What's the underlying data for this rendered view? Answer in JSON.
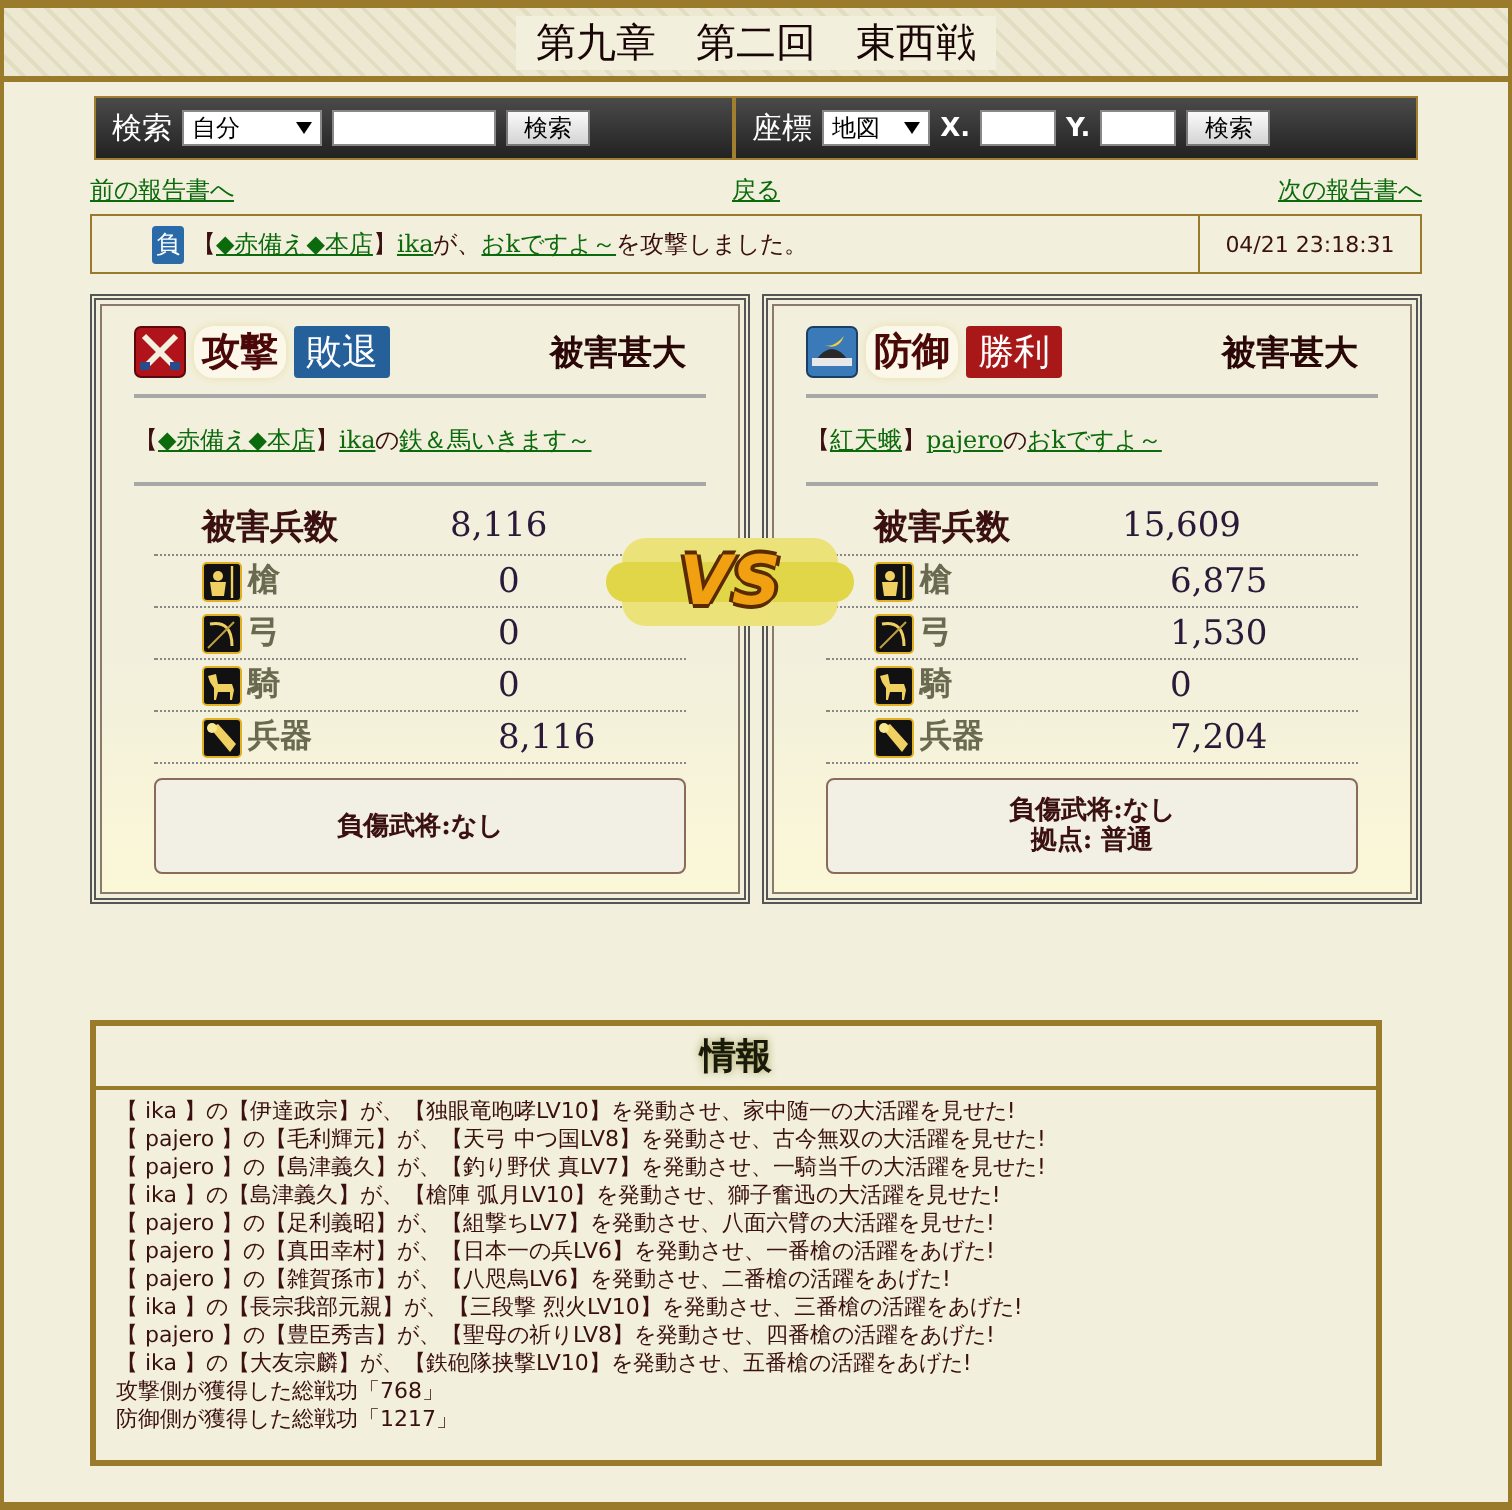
{
  "title": "第九章　第二回　東西戦",
  "search": {
    "label": "検索",
    "select": "自分",
    "button": "検索"
  },
  "coords": {
    "label": "座標",
    "select": "地図",
    "x_label": "X.",
    "y_label": "Y.",
    "button": "検索"
  },
  "nav": {
    "prev": "前の報告書へ",
    "back": "戻る",
    "next": "次の報告書へ"
  },
  "summary": {
    "badge": "負",
    "parts": [
      {
        "text": "【",
        "link": false
      },
      {
        "text": "◆赤備え◆本店",
        "link": true
      },
      {
        "text": "】",
        "link": false
      },
      {
        "text": "ika",
        "link": true
      },
      {
        "text": "が、",
        "link": false
      },
      {
        "text": "おkですよ～",
        "link": true
      },
      {
        "text": "を攻撃しました。",
        "link": false
      }
    ],
    "time": "04/21 23:18:31"
  },
  "sides": [
    {
      "kind": "attack",
      "role": "攻撃",
      "color": "#25609a",
      "result": "敗退",
      "damage": "被害甚大",
      "owner": [
        {
          "text": "【",
          "link": false
        },
        {
          "text": "◆赤備え◆本店",
          "link": true
        },
        {
          "text": " 】",
          "link": false
        },
        {
          "text": "ika",
          "link": true
        },
        {
          "text": " の",
          "link": false
        },
        {
          "text": "鉄＆馬いきます～",
          "link": true
        }
      ],
      "total_label": "被害兵数",
      "total_value": "8,116",
      "units": [
        {
          "kind": "spear",
          "label": "槍",
          "value": "0"
        },
        {
          "kind": "bow",
          "label": "弓",
          "value": "0"
        },
        {
          "kind": "horse",
          "label": "騎",
          "value": "0"
        },
        {
          "kind": "siege",
          "label": "兵器",
          "value": "8,116"
        }
      ],
      "notes": [
        "負傷武将:なし"
      ]
    },
    {
      "kind": "defense",
      "role": "防御",
      "color": "#a81818",
      "result": "勝利",
      "damage": "被害甚大",
      "owner": [
        {
          "text": "【",
          "link": false
        },
        {
          "text": "紅天蛾",
          "link": true
        },
        {
          "text": " 】",
          "link": false
        },
        {
          "text": "pajero",
          "link": true
        },
        {
          "text": " の",
          "link": false
        },
        {
          "text": "おkですよ～",
          "link": true
        }
      ],
      "total_label": "被害兵数",
      "total_value": "15,609",
      "units": [
        {
          "kind": "spear",
          "label": "槍",
          "value": "6,875"
        },
        {
          "kind": "bow",
          "label": "弓",
          "value": "1,530"
        },
        {
          "kind": "horse",
          "label": "騎",
          "value": "0"
        },
        {
          "kind": "siege",
          "label": "兵器",
          "value": "7,204"
        }
      ],
      "notes": [
        "負傷武将:なし",
        "拠点: 普通"
      ]
    }
  ],
  "vs": "VS",
  "info": {
    "title": "情報",
    "lines": [
      "【 ika 】の【伊達政宗】が、【独眼竜咆哮LV10】を発動させ、家中随一の大活躍を見せた!",
      "【 pajero 】の【毛利輝元】が、【天弓 中つ国LV8】を発動させ、古今無双の大活躍を見せた!",
      "【 pajero 】の【島津義久】が、【釣り野伏 真LV7】を発動させ、一騎当千の大活躍を見せた!",
      "【 ika 】の【島津義久】が、【槍陣 弧月LV10】を発動させ、獅子奮迅の大活躍を見せた!",
      "【 pajero 】の【足利義昭】が、【組撃ちLV7】を発動させ、八面六臂の大活躍を見せた!",
      "【 pajero 】の【真田幸村】が、【日本一の兵LV6】を発動させ、一番槍の活躍をあげた!",
      "【 pajero 】の【雑賀孫市】が、【八咫烏LV6】を発動させ、二番槍の活躍をあげた!",
      "【 ika 】の【長宗我部元親】が、【三段撃 烈火LV10】を発動させ、三番槍の活躍をあげた!",
      "【 pajero 】の【豊臣秀吉】が、【聖母の祈りLV8】を発動させ、四番槍の活躍をあげた!",
      "【 ika 】の【大友宗麟】が、【鉄砲隊挟撃LV10】を発動させ、五番槍の活躍をあげた!",
      "攻撃側が獲得した総戦功「768」",
      "防御側が獲得した総戦功「1217」"
    ]
  }
}
